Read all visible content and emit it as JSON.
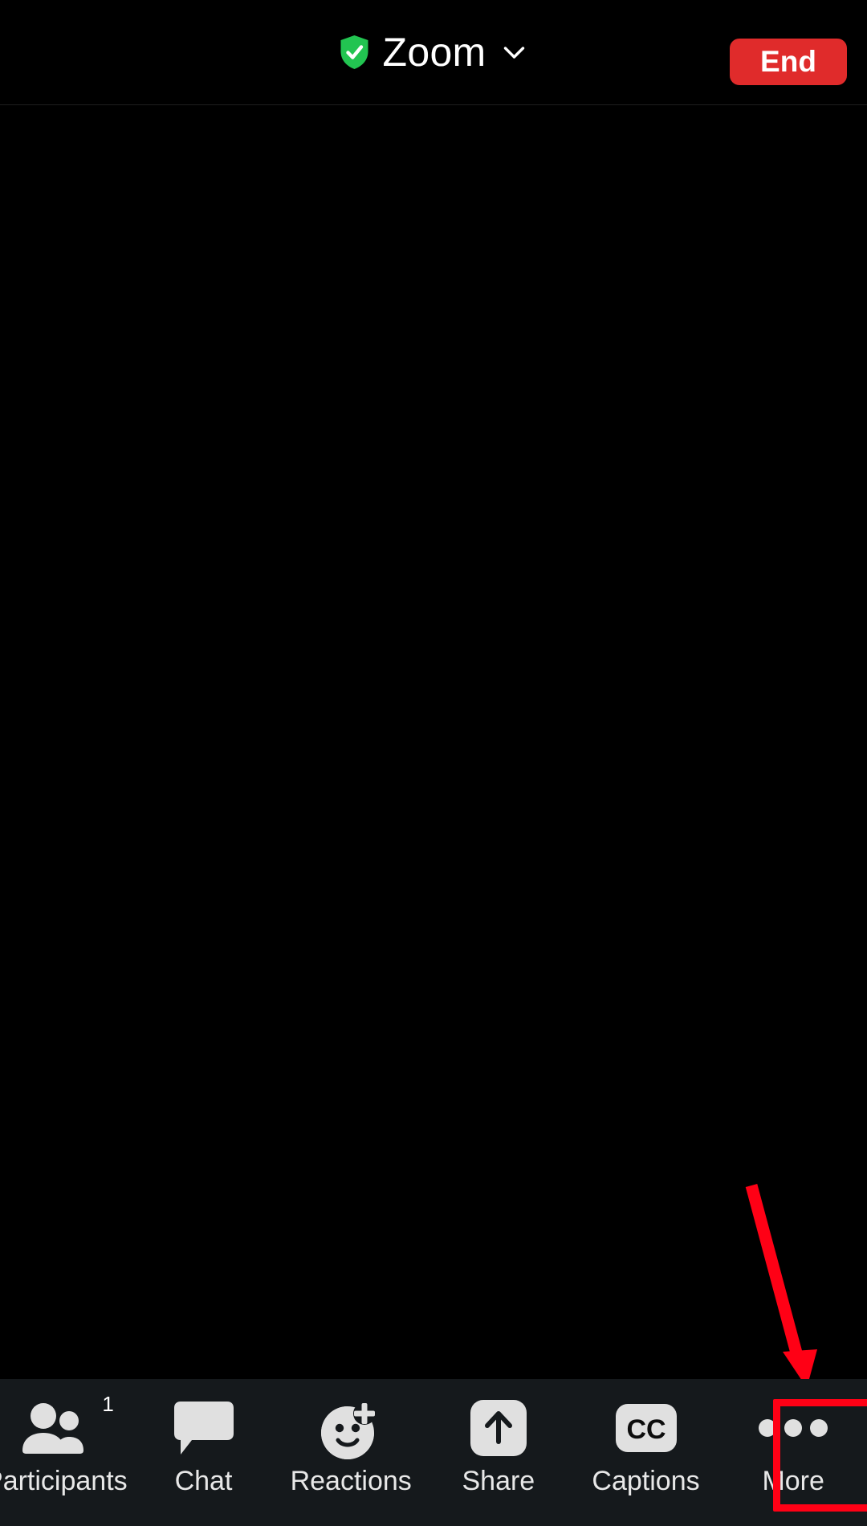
{
  "header": {
    "shield_icon": "shield-check-icon",
    "title": "Zoom",
    "chevron_icon": "chevron-down-icon",
    "end_label": "End",
    "end_color": "#e02b2b",
    "shield_color": "#22c451"
  },
  "stage": {
    "background_color": "#000000"
  },
  "annotation": {
    "arrow_color": "#ff0015",
    "highlight_color": "#ff0015",
    "highlight_target": "More"
  },
  "toolbar": {
    "background_color": "#15191c",
    "items": [
      {
        "label": "Participants",
        "icon": "participants-icon",
        "badge": "1"
      },
      {
        "label": "Chat",
        "icon": "chat-bubble-icon",
        "badge": ""
      },
      {
        "label": "Reactions",
        "icon": "reactions-smiley-plus-icon",
        "badge": ""
      },
      {
        "label": "Share",
        "icon": "share-up-arrow-icon",
        "badge": ""
      },
      {
        "label": "Captions",
        "icon": "closed-captions-icon",
        "badge": ""
      },
      {
        "label": "More",
        "icon": "more-dots-icon",
        "badge": ""
      }
    ]
  }
}
